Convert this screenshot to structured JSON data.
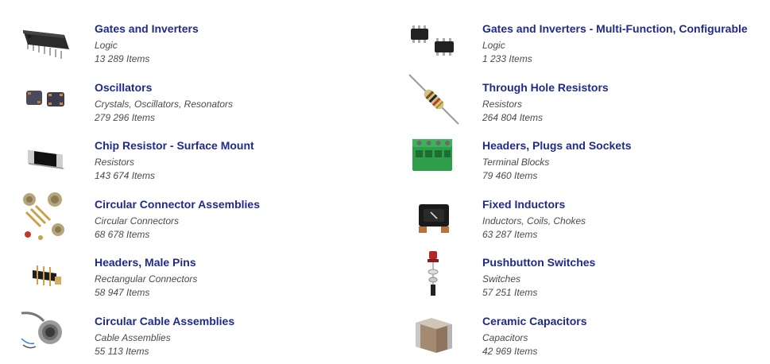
{
  "categories": [
    {
      "title": "Gates and Inverters",
      "subcategory": "Logic",
      "count": "13 289 Items",
      "icon": "dip-ic-icon"
    },
    {
      "title": "Gates and Inverters - Multi-Function, Configurable",
      "subcategory": "Logic",
      "count": "1 233 Items",
      "icon": "smd-ic-icon"
    },
    {
      "title": "Oscillators",
      "subcategory": "Crystals, Oscillators, Resonators",
      "count": "279 296 Items",
      "icon": "oscillator-icon"
    },
    {
      "title": "Through Hole Resistors",
      "subcategory": "Resistors",
      "count": "264 804 Items",
      "icon": "axial-resistor-icon"
    },
    {
      "title": "Chip Resistor - Surface Mount",
      "subcategory": "Resistors",
      "count": "143 674 Items",
      "icon": "chip-resistor-icon"
    },
    {
      "title": "Headers, Plugs and Sockets",
      "subcategory": "Terminal Blocks",
      "count": "79 460 Items",
      "icon": "terminal-block-icon"
    },
    {
      "title": "Circular Connector Assemblies",
      "subcategory": "Circular Connectors",
      "count": "68 678 Items",
      "icon": "circular-connector-icon"
    },
    {
      "title": "Fixed Inductors",
      "subcategory": "Inductors, Coils, Chokes",
      "count": "63 287 Items",
      "icon": "inductor-icon"
    },
    {
      "title": "Headers, Male Pins",
      "subcategory": "Rectangular Connectors",
      "count": "58 947 Items",
      "icon": "pin-header-icon"
    },
    {
      "title": "Pushbutton Switches",
      "subcategory": "Switches",
      "count": "57 251 Items",
      "icon": "pushbutton-icon"
    },
    {
      "title": "Circular Cable Assemblies",
      "subcategory": "Cable Assemblies",
      "count": "55 113 Items",
      "icon": "cable-assembly-icon"
    },
    {
      "title": "Ceramic Capacitors",
      "subcategory": "Capacitors",
      "count": "42 969 Items",
      "icon": "ceramic-capacitor-icon"
    }
  ],
  "colors": {
    "title": "#1f2a8a",
    "text": "#4a4a4a"
  }
}
